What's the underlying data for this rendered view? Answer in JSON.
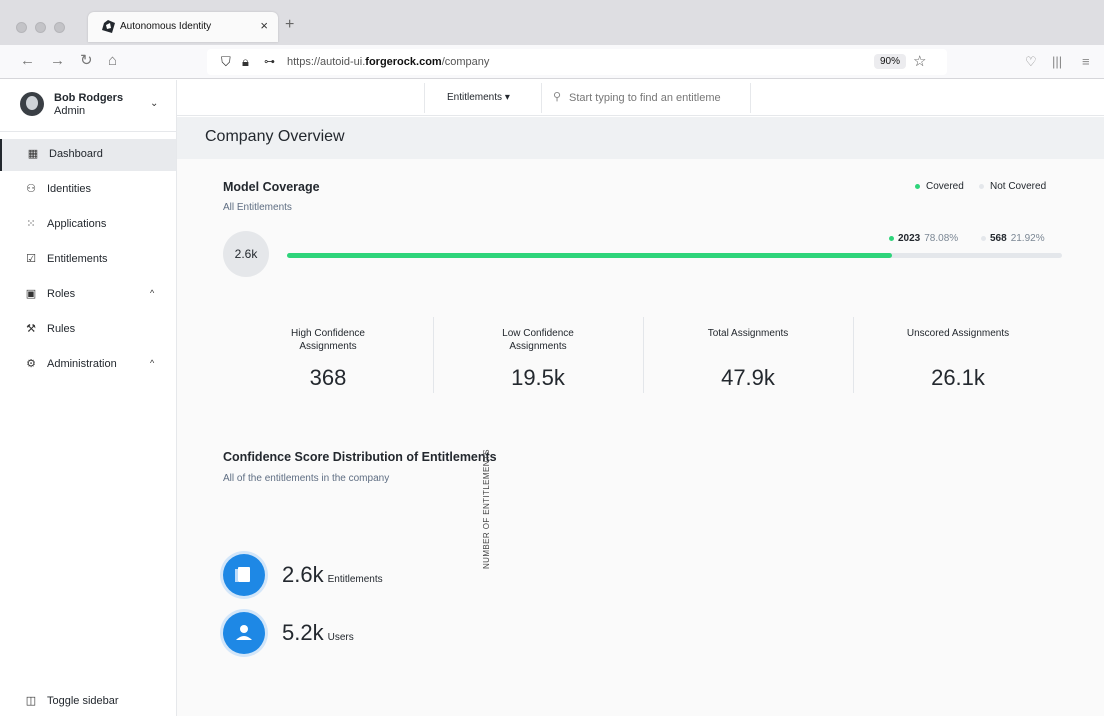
{
  "browser": {
    "tab_title": "Autonomous Identity",
    "tab_close": "×",
    "new_tab": "+",
    "url_prefix": "https://autoid-ui.",
    "url_domain": "forgerock.com",
    "url_path": "/company",
    "zoom": "90%",
    "nav_icons": [
      "back-icon",
      "forward-icon",
      "reload-icon",
      "home-icon"
    ]
  },
  "user": {
    "name": "Bob Rodgers",
    "role": "Admin"
  },
  "sidebar": {
    "items": [
      {
        "label": "Dashboard",
        "icon": "dashboard-icon",
        "active": true
      },
      {
        "label": "Identities",
        "icon": "identities-icon"
      },
      {
        "label": "Applications",
        "icon": "applications-icon"
      },
      {
        "label": "Entitlements",
        "icon": "entitlements-icon"
      },
      {
        "label": "Roles",
        "icon": "roles-icon",
        "expandable": true
      },
      {
        "label": "Rules",
        "icon": "rules-icon"
      },
      {
        "label": "Administration",
        "icon": "gear-icon",
        "expandable": true
      }
    ],
    "toggle_label": "Toggle sidebar"
  },
  "topbar": {
    "filter_label": "Entitlements",
    "search_placeholder": "Start typing to find an entitleme"
  },
  "page": {
    "title": "Company Overview"
  },
  "coverage": {
    "title": "Model Coverage",
    "subtitle": "All Entitlements",
    "legend_covered": "Covered",
    "legend_not_covered": "Not Covered",
    "total": "2.6k",
    "covered_count": "2023",
    "covered_pct": "78.08%",
    "not_covered_count": "568",
    "not_covered_pct": "21.92%",
    "covered_fraction": 0.7808,
    "colors": {
      "covered": "#2ed47a",
      "not_covered": "#e4e7eb"
    }
  },
  "stats": [
    {
      "label": "High Confidence Assignments",
      "value": "368"
    },
    {
      "label": "Low Confidence Assignments",
      "value": "19.5k"
    },
    {
      "label": "Total Assignments",
      "value": "47.9k"
    },
    {
      "label": "Unscored Assignments",
      "value": "26.1k"
    }
  ],
  "distribution": {
    "title": "Confidence Score Distribution of Entitlements",
    "subtitle": "All of the entitlements in the company",
    "entitlements_value": "2.6k",
    "entitlements_unit": "Entitlements",
    "users_value": "5.2k",
    "users_unit": "Users",
    "axis_label": "NUMBER OF ENTITLEMENTS",
    "accent": "#1e88e5"
  }
}
